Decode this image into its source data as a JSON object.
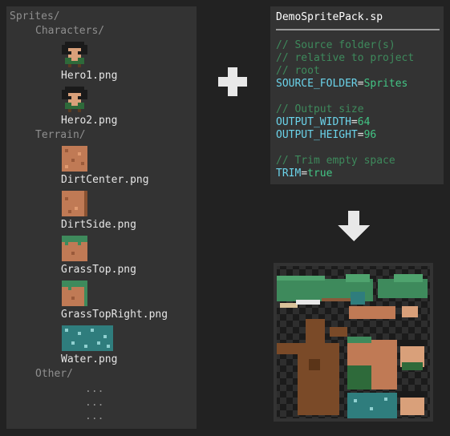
{
  "tree": {
    "root": "Sprites/",
    "characters_folder": "Characters/",
    "hero1": "Hero1.png",
    "hero2": "Hero2.png",
    "terrain_folder": "Terrain/",
    "dirt_center": "DirtCenter.png",
    "dirt_side": "DirtSide.png",
    "grass_top": "GrassTop.png",
    "grass_top_right": "GrassTopRight.png",
    "water": "Water.png",
    "other_folder": "Other/",
    "ellipsis": [
      "...",
      "...",
      "..."
    ]
  },
  "code": {
    "filename": "DemoSpritePack.sp",
    "comment1": [
      "// Source folder(s)",
      "// relative to project",
      "// root"
    ],
    "source_key": "SOURCE_FOLDER",
    "source_val": "Sprites",
    "comment2": "// Output size",
    "width_key": "OUTPUT_WIDTH",
    "width_val": "64",
    "height_key": "OUTPUT_HEIGHT",
    "height_val": "96",
    "comment3": "// Trim empty space",
    "trim_key": "TRIM",
    "trim_val": "true",
    "eq": "="
  },
  "icons": {
    "plus": "plus-icon",
    "arrow": "arrow-down-icon"
  },
  "colors": {
    "background": "#222222",
    "panel": "#333333",
    "comment": "#3e8a5c",
    "key": "#6bd3ea",
    "value": "#43c585",
    "dirt": "#c07a55",
    "grass": "#3e8a5c",
    "water": "#2f7d7d",
    "wood": "#7a4a28"
  }
}
